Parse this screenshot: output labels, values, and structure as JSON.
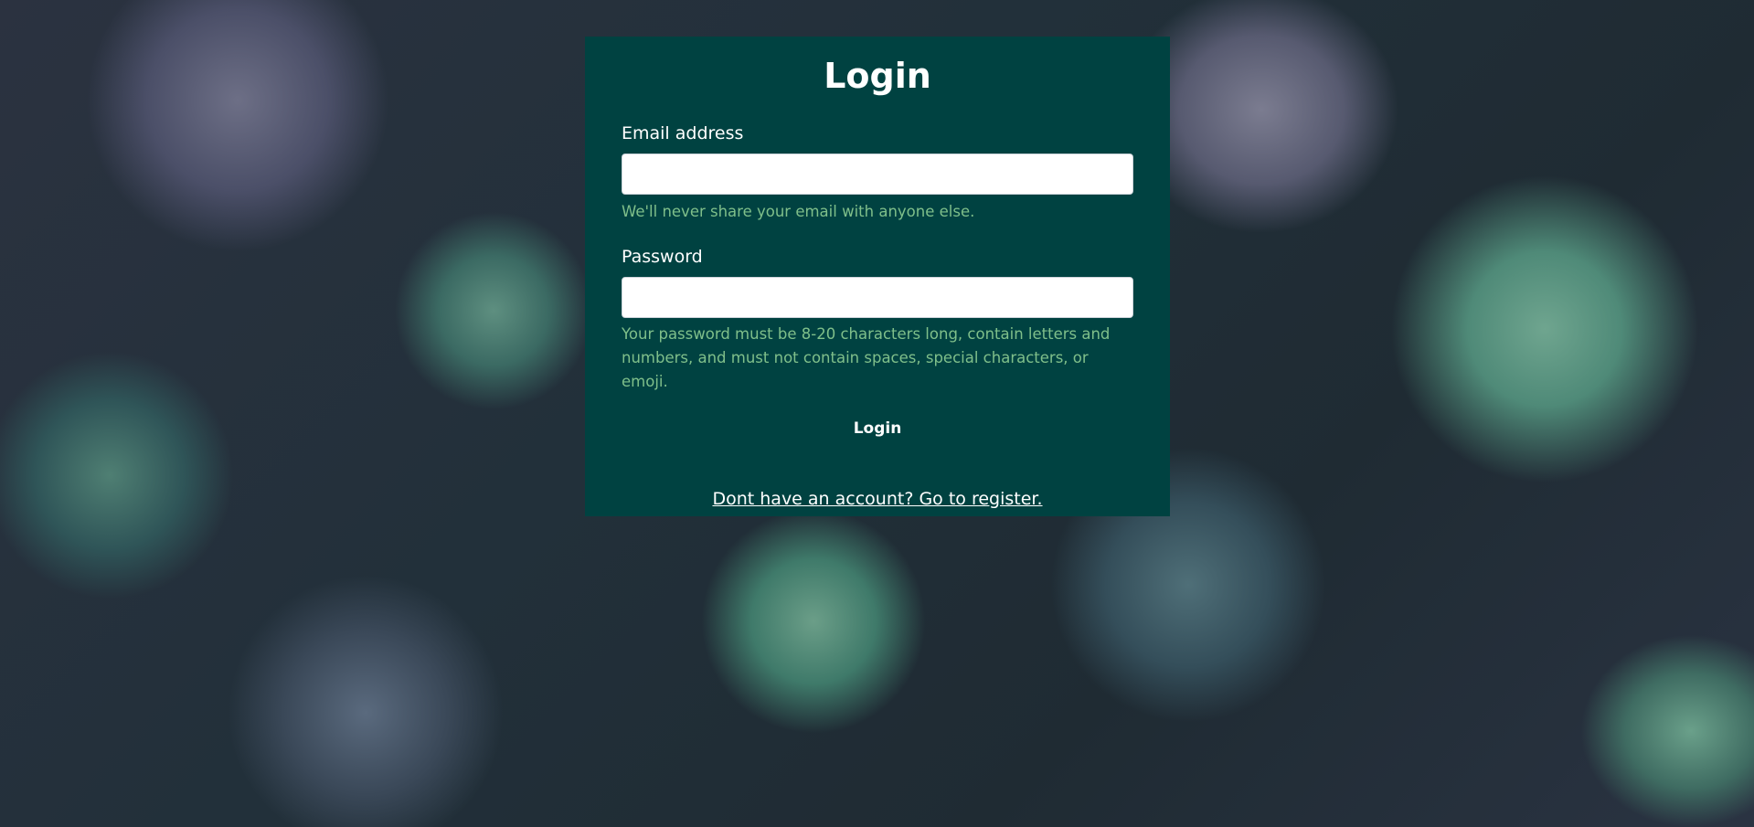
{
  "colors": {
    "card_background": "#004241",
    "help_text": "#7fbf8a",
    "text": "#ffffff"
  },
  "background": {
    "description_icon": "succulent-photo-background"
  },
  "login_form": {
    "title": "Login",
    "email": {
      "label": "Email address",
      "value": "",
      "placeholder": "",
      "help": "We'll never share your email with anyone else."
    },
    "password": {
      "label": "Password",
      "value": "",
      "placeholder": "",
      "help": "Your password must be 8-20 characters long, contain letters and numbers, and must not contain spaces, special characters, or emoji."
    },
    "submit_label": "Login",
    "register_link": "Dont have an account? Go to register."
  }
}
